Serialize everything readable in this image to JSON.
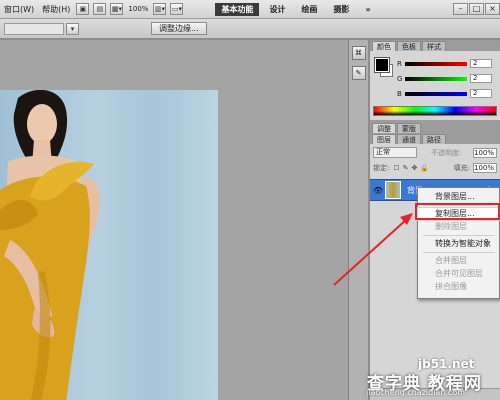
{
  "menubar": {
    "items": [
      "窗口(W)",
      "帮助(H)"
    ],
    "zoom": "100%",
    "workspaces": [
      "基本功能",
      "设计",
      "绘画",
      "摄影"
    ],
    "more": "»",
    "window_buttons": [
      "–",
      "□",
      "×"
    ]
  },
  "options": {
    "refine_edge": "调整边缘..."
  },
  "color_panel": {
    "tabs": [
      "颜色",
      "色板",
      "样式"
    ],
    "sliders": [
      {
        "letter": "R",
        "value": "2",
        "gradient": "linear-gradient(90deg,#000,#f00)"
      },
      {
        "letter": "G",
        "value": "2",
        "gradient": "linear-gradient(90deg,#000,#0f0)"
      },
      {
        "letter": "B",
        "value": "2",
        "gradient": "linear-gradient(90deg,#000,#00f)"
      }
    ],
    "foreground": "#000000",
    "background": "#ffffff"
  },
  "adjustments_panel": {
    "tabs": [
      "调整",
      "蒙版"
    ]
  },
  "layers_panel": {
    "tabs": [
      "图层",
      "通道",
      "路径"
    ],
    "blend_mode": "正常",
    "opacity_label": "不透明度:",
    "opacity": "100%",
    "lock_label": "锁定:",
    "lock_icons": [
      "☐",
      "✎",
      "✥",
      "🔒"
    ],
    "fill_label": "填充:",
    "fill": "100%",
    "layer": {
      "name": "背景",
      "lock": "🔒"
    }
  },
  "context_menu": {
    "items": [
      {
        "label": "背景图层...",
        "disabled": false
      },
      {
        "label": "复制图层...",
        "disabled": false
      },
      {
        "label": "删除图层",
        "disabled": true
      },
      {
        "label": "转换为智能对象",
        "disabled": false
      },
      {
        "label": "合并图层",
        "disabled": true
      },
      {
        "label": "合并可见图层",
        "disabled": true
      },
      {
        "label": "拼合图像",
        "disabled": true
      }
    ]
  },
  "watermark": {
    "site": "jb51.net",
    "brand": "查字典 教程网",
    "url": "jiaocheng.chazidian.com"
  },
  "accent": {
    "highlight_red": "#e2232a",
    "selection_blue": "#3a78d6"
  }
}
